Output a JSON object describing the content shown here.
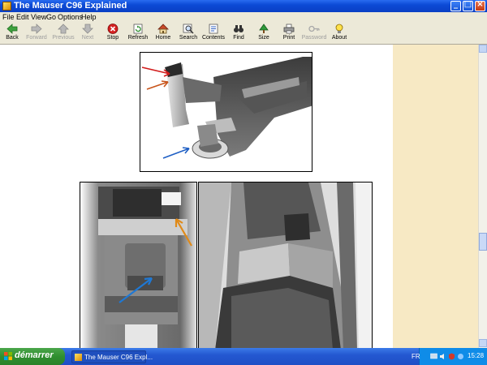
{
  "window": {
    "title": "The Mauser C96 Explained"
  },
  "menu": [
    "File",
    "Edit",
    "View",
    "Go",
    "Options",
    "Help"
  ],
  "toolbar": {
    "back": "Back",
    "forward": "Forward",
    "previous": "Previous",
    "next": "Next",
    "stop": "Stop",
    "refresh": "Refresh",
    "home": "Home",
    "search": "Search",
    "contents": "Contents",
    "find": "Find",
    "size": "Size",
    "print": "Print",
    "password": "Password",
    "about": "About"
  },
  "colors": {
    "titlebar": "#0c4ad6",
    "page_margin": "#f7e9c4",
    "taskbar": "#2458d1",
    "start": "#2f8f2f"
  },
  "taskbar": {
    "start_label": "démarrer",
    "task_label": "The Mauser C96 Expl...",
    "language": "FR",
    "clock": "15:28"
  }
}
